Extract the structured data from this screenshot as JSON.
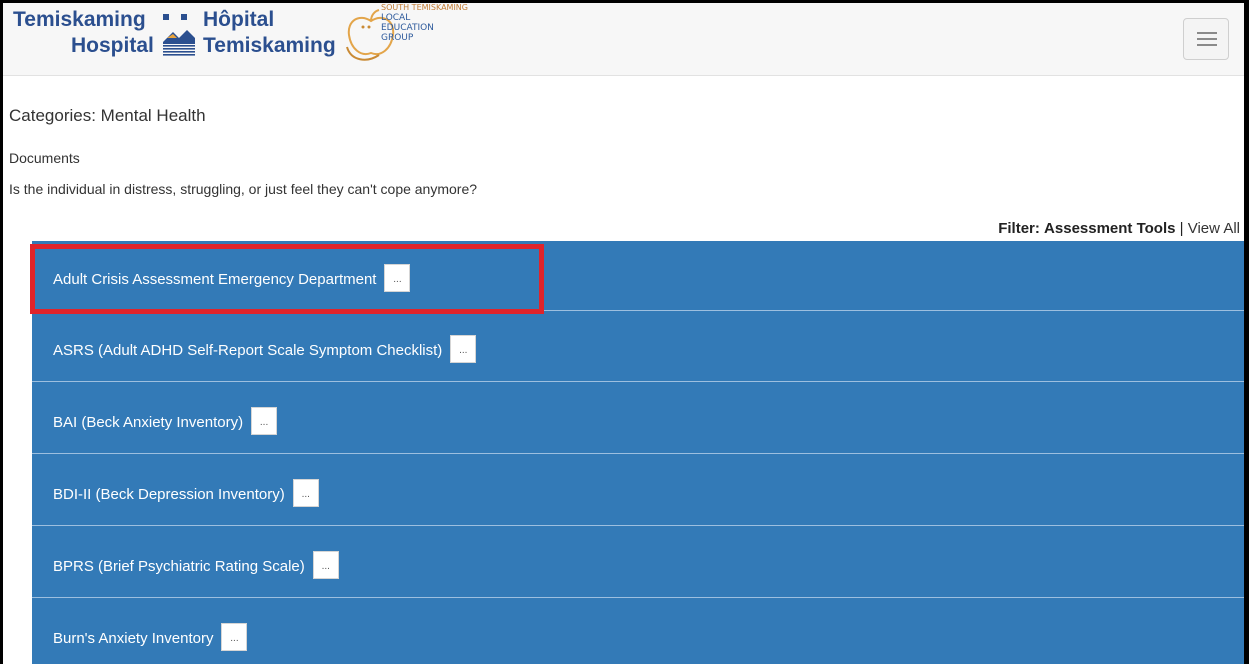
{
  "header": {
    "logo_left": {
      "line1": "Temiskaming",
      "line2": "Hospital",
      "line3": "Hôpital",
      "line4": "Temiskaming"
    },
    "logo_right": {
      "line1": "SOUTH TEMISKAMING",
      "line2": "LOCAL",
      "line3": "EDUCATION",
      "line4": "GROUP"
    },
    "menu_icon": "hamburger-icon"
  },
  "page": {
    "categories_prefix": "Categories:",
    "category": "Mental Health",
    "documents_label": "Documents",
    "question": "Is the individual in distress, struggling, or just feel they can't cope anymore?"
  },
  "filter": {
    "label": "Filter:",
    "active": "Assessment Tools",
    "separator": "|",
    "view_all": "View All"
  },
  "documents": [
    {
      "title": "Adult Crisis Assessment Emergency Department",
      "more": "..."
    },
    {
      "title": "ASRS (Adult ADHD Self-Report Scale Symptom Checklist)",
      "more": "..."
    },
    {
      "title": "BAI (Beck Anxiety Inventory)",
      "more": "..."
    },
    {
      "title": "BDI-II (Beck Depression Inventory)",
      "more": "..."
    },
    {
      "title": "BPRS (Brief Psychiatric Rating Scale)",
      "more": "..."
    },
    {
      "title": "Burn's Anxiety Inventory",
      "more": "..."
    }
  ],
  "colors": {
    "list_background": "#337ab7",
    "highlight_border": "#e0242b",
    "logo_blue": "#2b4f8f"
  }
}
